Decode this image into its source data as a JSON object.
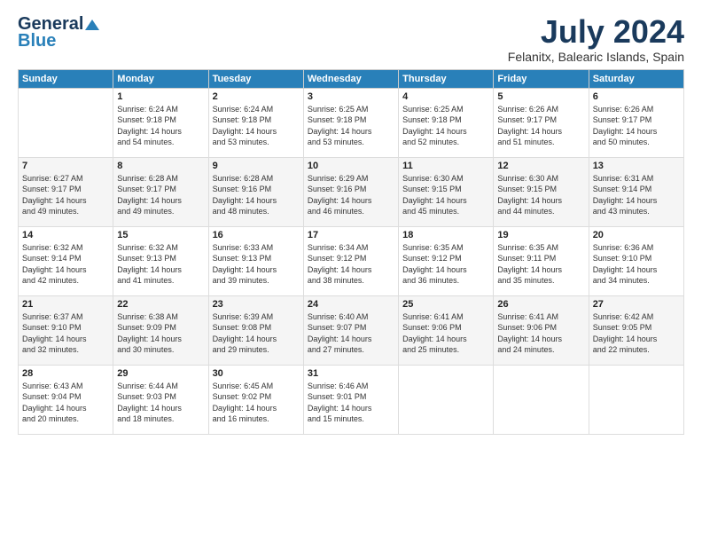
{
  "header": {
    "logo_general": "General",
    "logo_blue": "Blue",
    "month_title": "July 2024",
    "location": "Felanitx, Balearic Islands, Spain"
  },
  "days_of_week": [
    "Sunday",
    "Monday",
    "Tuesday",
    "Wednesday",
    "Thursday",
    "Friday",
    "Saturday"
  ],
  "weeks": [
    [
      {
        "day": "",
        "content": ""
      },
      {
        "day": "1",
        "content": "Sunrise: 6:24 AM\nSunset: 9:18 PM\nDaylight: 14 hours\nand 54 minutes."
      },
      {
        "day": "2",
        "content": "Sunrise: 6:24 AM\nSunset: 9:18 PM\nDaylight: 14 hours\nand 53 minutes."
      },
      {
        "day": "3",
        "content": "Sunrise: 6:25 AM\nSunset: 9:18 PM\nDaylight: 14 hours\nand 53 minutes."
      },
      {
        "day": "4",
        "content": "Sunrise: 6:25 AM\nSunset: 9:18 PM\nDaylight: 14 hours\nand 52 minutes."
      },
      {
        "day": "5",
        "content": "Sunrise: 6:26 AM\nSunset: 9:17 PM\nDaylight: 14 hours\nand 51 minutes."
      },
      {
        "day": "6",
        "content": "Sunrise: 6:26 AM\nSunset: 9:17 PM\nDaylight: 14 hours\nand 50 minutes."
      }
    ],
    [
      {
        "day": "7",
        "content": "Sunrise: 6:27 AM\nSunset: 9:17 PM\nDaylight: 14 hours\nand 49 minutes."
      },
      {
        "day": "8",
        "content": "Sunrise: 6:28 AM\nSunset: 9:17 PM\nDaylight: 14 hours\nand 49 minutes."
      },
      {
        "day": "9",
        "content": "Sunrise: 6:28 AM\nSunset: 9:16 PM\nDaylight: 14 hours\nand 48 minutes."
      },
      {
        "day": "10",
        "content": "Sunrise: 6:29 AM\nSunset: 9:16 PM\nDaylight: 14 hours\nand 46 minutes."
      },
      {
        "day": "11",
        "content": "Sunrise: 6:30 AM\nSunset: 9:15 PM\nDaylight: 14 hours\nand 45 minutes."
      },
      {
        "day": "12",
        "content": "Sunrise: 6:30 AM\nSunset: 9:15 PM\nDaylight: 14 hours\nand 44 minutes."
      },
      {
        "day": "13",
        "content": "Sunrise: 6:31 AM\nSunset: 9:14 PM\nDaylight: 14 hours\nand 43 minutes."
      }
    ],
    [
      {
        "day": "14",
        "content": "Sunrise: 6:32 AM\nSunset: 9:14 PM\nDaylight: 14 hours\nand 42 minutes."
      },
      {
        "day": "15",
        "content": "Sunrise: 6:32 AM\nSunset: 9:13 PM\nDaylight: 14 hours\nand 41 minutes."
      },
      {
        "day": "16",
        "content": "Sunrise: 6:33 AM\nSunset: 9:13 PM\nDaylight: 14 hours\nand 39 minutes."
      },
      {
        "day": "17",
        "content": "Sunrise: 6:34 AM\nSunset: 9:12 PM\nDaylight: 14 hours\nand 38 minutes."
      },
      {
        "day": "18",
        "content": "Sunrise: 6:35 AM\nSunset: 9:12 PM\nDaylight: 14 hours\nand 36 minutes."
      },
      {
        "day": "19",
        "content": "Sunrise: 6:35 AM\nSunset: 9:11 PM\nDaylight: 14 hours\nand 35 minutes."
      },
      {
        "day": "20",
        "content": "Sunrise: 6:36 AM\nSunset: 9:10 PM\nDaylight: 14 hours\nand 34 minutes."
      }
    ],
    [
      {
        "day": "21",
        "content": "Sunrise: 6:37 AM\nSunset: 9:10 PM\nDaylight: 14 hours\nand 32 minutes."
      },
      {
        "day": "22",
        "content": "Sunrise: 6:38 AM\nSunset: 9:09 PM\nDaylight: 14 hours\nand 30 minutes."
      },
      {
        "day": "23",
        "content": "Sunrise: 6:39 AM\nSunset: 9:08 PM\nDaylight: 14 hours\nand 29 minutes."
      },
      {
        "day": "24",
        "content": "Sunrise: 6:40 AM\nSunset: 9:07 PM\nDaylight: 14 hours\nand 27 minutes."
      },
      {
        "day": "25",
        "content": "Sunrise: 6:41 AM\nSunset: 9:06 PM\nDaylight: 14 hours\nand 25 minutes."
      },
      {
        "day": "26",
        "content": "Sunrise: 6:41 AM\nSunset: 9:06 PM\nDaylight: 14 hours\nand 24 minutes."
      },
      {
        "day": "27",
        "content": "Sunrise: 6:42 AM\nSunset: 9:05 PM\nDaylight: 14 hours\nand 22 minutes."
      }
    ],
    [
      {
        "day": "28",
        "content": "Sunrise: 6:43 AM\nSunset: 9:04 PM\nDaylight: 14 hours\nand 20 minutes."
      },
      {
        "day": "29",
        "content": "Sunrise: 6:44 AM\nSunset: 9:03 PM\nDaylight: 14 hours\nand 18 minutes."
      },
      {
        "day": "30",
        "content": "Sunrise: 6:45 AM\nSunset: 9:02 PM\nDaylight: 14 hours\nand 16 minutes."
      },
      {
        "day": "31",
        "content": "Sunrise: 6:46 AM\nSunset: 9:01 PM\nDaylight: 14 hours\nand 15 minutes."
      },
      {
        "day": "",
        "content": ""
      },
      {
        "day": "",
        "content": ""
      },
      {
        "day": "",
        "content": ""
      }
    ]
  ]
}
